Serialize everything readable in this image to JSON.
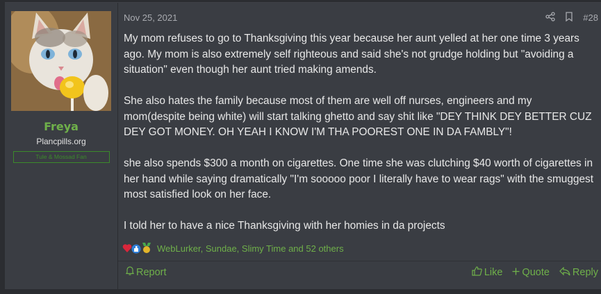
{
  "user": {
    "name": "Freya",
    "title": "Plancpills.org",
    "banner": "Tule & Mossad Fan"
  },
  "post": {
    "date": "Nov 25, 2021",
    "number": "#28",
    "paragraphs": [
      "My mom refuses to go to Thanksgiving this year because her aunt yelled at her one time 3 years ago. My mom is also extremely self righteous and said she's not grudge holding but \"avoiding a situation\" even though her aunt tried making amends.",
      "She also hates the family because most of them are well off nurses, engineers and my mom(despite being white) will start talking ghetto and say shit like \"DEY THINK DEY BETTER CUZ DEY GOT MONEY. OH YEAH I KNOW I'M THA POOREST ONE IN DA FAMBLY\"!",
      "she also spends $300 a month on cigarettes. One time she was clutching $40 worth of cigarettes in her hand while saying dramatically \"I'm sooooo poor I literally have to wear rags\" with the smuggest most satisfied look on her face.",
      "I told her to have a nice Thanksgiving with her homies in da projects"
    ]
  },
  "reactions": {
    "text": "WebLurker, Sundae, Slimy Time and 52 others",
    "icons": [
      "heart-icon",
      "thumbs-up-icon",
      "medal-icon"
    ]
  },
  "footer": {
    "report": "Report",
    "like": "Like",
    "quote": "Quote",
    "reply": "Reply"
  },
  "colors": {
    "accent": "#6fb04a",
    "background": "#3a3d43",
    "page": "#2b2d31"
  }
}
